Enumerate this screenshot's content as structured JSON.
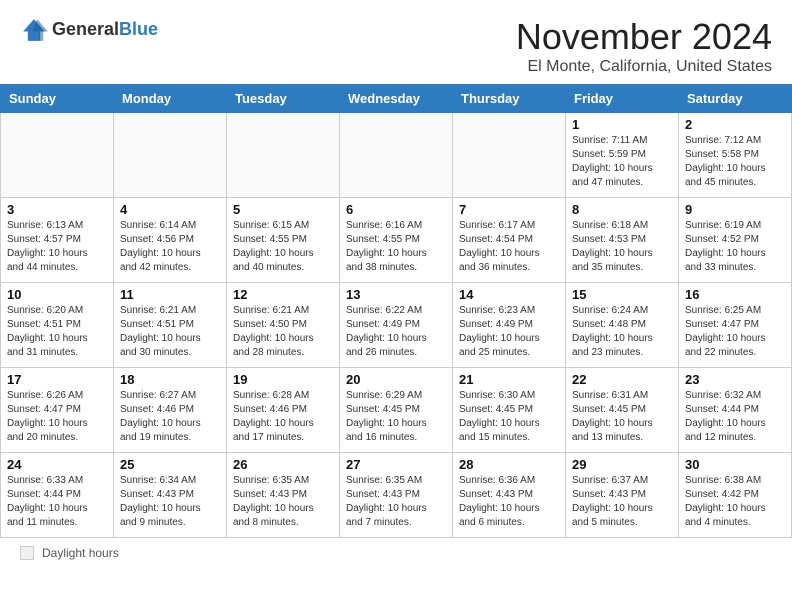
{
  "header": {
    "logo": {
      "line1": "General",
      "line2": "Blue"
    },
    "title": "November 2024",
    "location": "El Monte, California, United States"
  },
  "weekdays": [
    "Sunday",
    "Monday",
    "Tuesday",
    "Wednesday",
    "Thursday",
    "Friday",
    "Saturday"
  ],
  "weeks": [
    [
      {
        "day": "",
        "info": ""
      },
      {
        "day": "",
        "info": ""
      },
      {
        "day": "",
        "info": ""
      },
      {
        "day": "",
        "info": ""
      },
      {
        "day": "",
        "info": ""
      },
      {
        "day": "1",
        "info": "Sunrise: 7:11 AM\nSunset: 5:59 PM\nDaylight: 10 hours\nand 47 minutes."
      },
      {
        "day": "2",
        "info": "Sunrise: 7:12 AM\nSunset: 5:58 PM\nDaylight: 10 hours\nand 45 minutes."
      }
    ],
    [
      {
        "day": "3",
        "info": "Sunrise: 6:13 AM\nSunset: 4:57 PM\nDaylight: 10 hours\nand 44 minutes."
      },
      {
        "day": "4",
        "info": "Sunrise: 6:14 AM\nSunset: 4:56 PM\nDaylight: 10 hours\nand 42 minutes."
      },
      {
        "day": "5",
        "info": "Sunrise: 6:15 AM\nSunset: 4:55 PM\nDaylight: 10 hours\nand 40 minutes."
      },
      {
        "day": "6",
        "info": "Sunrise: 6:16 AM\nSunset: 4:55 PM\nDaylight: 10 hours\nand 38 minutes."
      },
      {
        "day": "7",
        "info": "Sunrise: 6:17 AM\nSunset: 4:54 PM\nDaylight: 10 hours\nand 36 minutes."
      },
      {
        "day": "8",
        "info": "Sunrise: 6:18 AM\nSunset: 4:53 PM\nDaylight: 10 hours\nand 35 minutes."
      },
      {
        "day": "9",
        "info": "Sunrise: 6:19 AM\nSunset: 4:52 PM\nDaylight: 10 hours\nand 33 minutes."
      }
    ],
    [
      {
        "day": "10",
        "info": "Sunrise: 6:20 AM\nSunset: 4:51 PM\nDaylight: 10 hours\nand 31 minutes."
      },
      {
        "day": "11",
        "info": "Sunrise: 6:21 AM\nSunset: 4:51 PM\nDaylight: 10 hours\nand 30 minutes."
      },
      {
        "day": "12",
        "info": "Sunrise: 6:21 AM\nSunset: 4:50 PM\nDaylight: 10 hours\nand 28 minutes."
      },
      {
        "day": "13",
        "info": "Sunrise: 6:22 AM\nSunset: 4:49 PM\nDaylight: 10 hours\nand 26 minutes."
      },
      {
        "day": "14",
        "info": "Sunrise: 6:23 AM\nSunset: 4:49 PM\nDaylight: 10 hours\nand 25 minutes."
      },
      {
        "day": "15",
        "info": "Sunrise: 6:24 AM\nSunset: 4:48 PM\nDaylight: 10 hours\nand 23 minutes."
      },
      {
        "day": "16",
        "info": "Sunrise: 6:25 AM\nSunset: 4:47 PM\nDaylight: 10 hours\nand 22 minutes."
      }
    ],
    [
      {
        "day": "17",
        "info": "Sunrise: 6:26 AM\nSunset: 4:47 PM\nDaylight: 10 hours\nand 20 minutes."
      },
      {
        "day": "18",
        "info": "Sunrise: 6:27 AM\nSunset: 4:46 PM\nDaylight: 10 hours\nand 19 minutes."
      },
      {
        "day": "19",
        "info": "Sunrise: 6:28 AM\nSunset: 4:46 PM\nDaylight: 10 hours\nand 17 minutes."
      },
      {
        "day": "20",
        "info": "Sunrise: 6:29 AM\nSunset: 4:45 PM\nDaylight: 10 hours\nand 16 minutes."
      },
      {
        "day": "21",
        "info": "Sunrise: 6:30 AM\nSunset: 4:45 PM\nDaylight: 10 hours\nand 15 minutes."
      },
      {
        "day": "22",
        "info": "Sunrise: 6:31 AM\nSunset: 4:45 PM\nDaylight: 10 hours\nand 13 minutes."
      },
      {
        "day": "23",
        "info": "Sunrise: 6:32 AM\nSunset: 4:44 PM\nDaylight: 10 hours\nand 12 minutes."
      }
    ],
    [
      {
        "day": "24",
        "info": "Sunrise: 6:33 AM\nSunset: 4:44 PM\nDaylight: 10 hours\nand 11 minutes."
      },
      {
        "day": "25",
        "info": "Sunrise: 6:34 AM\nSunset: 4:43 PM\nDaylight: 10 hours\nand 9 minutes."
      },
      {
        "day": "26",
        "info": "Sunrise: 6:35 AM\nSunset: 4:43 PM\nDaylight: 10 hours\nand 8 minutes."
      },
      {
        "day": "27",
        "info": "Sunrise: 6:35 AM\nSunset: 4:43 PM\nDaylight: 10 hours\nand 7 minutes."
      },
      {
        "day": "28",
        "info": "Sunrise: 6:36 AM\nSunset: 4:43 PM\nDaylight: 10 hours\nand 6 minutes."
      },
      {
        "day": "29",
        "info": "Sunrise: 6:37 AM\nSunset: 4:43 PM\nDaylight: 10 hours\nand 5 minutes."
      },
      {
        "day": "30",
        "info": "Sunrise: 6:38 AM\nSunset: 4:42 PM\nDaylight: 10 hours\nand 4 minutes."
      }
    ]
  ],
  "legend": {
    "box_label": "Daylight hours"
  }
}
